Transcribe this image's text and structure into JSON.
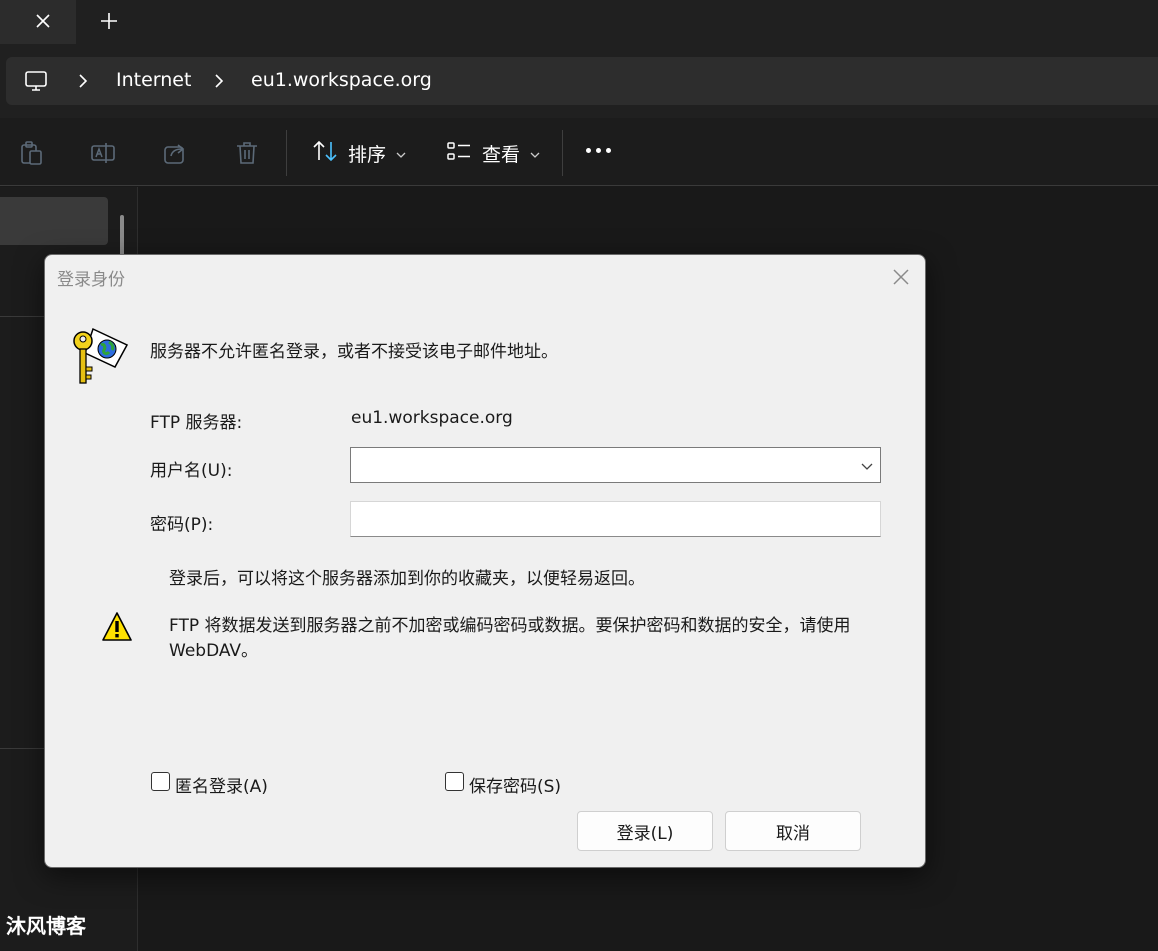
{
  "address": {
    "crumbs": [
      "Internet",
      "eu1.workspace.org"
    ]
  },
  "toolbar": {
    "sort_label": "排序",
    "view_label": "查看"
  },
  "watermark": "沐风博客",
  "dialog": {
    "title": "登录身份",
    "message": "服务器不允许匿名登录，或者不接受该电子邮件地址。",
    "server_label": "FTP 服务器:",
    "server_value": "eu1.workspace.org",
    "username_label": "用户名(U):",
    "username_value": "",
    "password_label": "密码(P):",
    "password_value": "",
    "favorites_note": "登录后，可以将这个服务器添加到你的收藏夹，以便轻易返回。",
    "warning_line1": "FTP 将数据发送到服务器之前不加密或编码密码或数据。要保护密码和数据的安全，请使用",
    "warning_line2": "WebDAV。",
    "anonymous_label": "匿名登录(A)",
    "anonymous_checked": false,
    "save_password_label": "保存密码(S)",
    "save_password_checked": false,
    "login_button": "登录(L)",
    "cancel_button": "取消"
  },
  "colors": {
    "window_bg": "#191919",
    "dialog_bg": "#f0f0f0",
    "sort_accent": "#4cc2ff"
  }
}
